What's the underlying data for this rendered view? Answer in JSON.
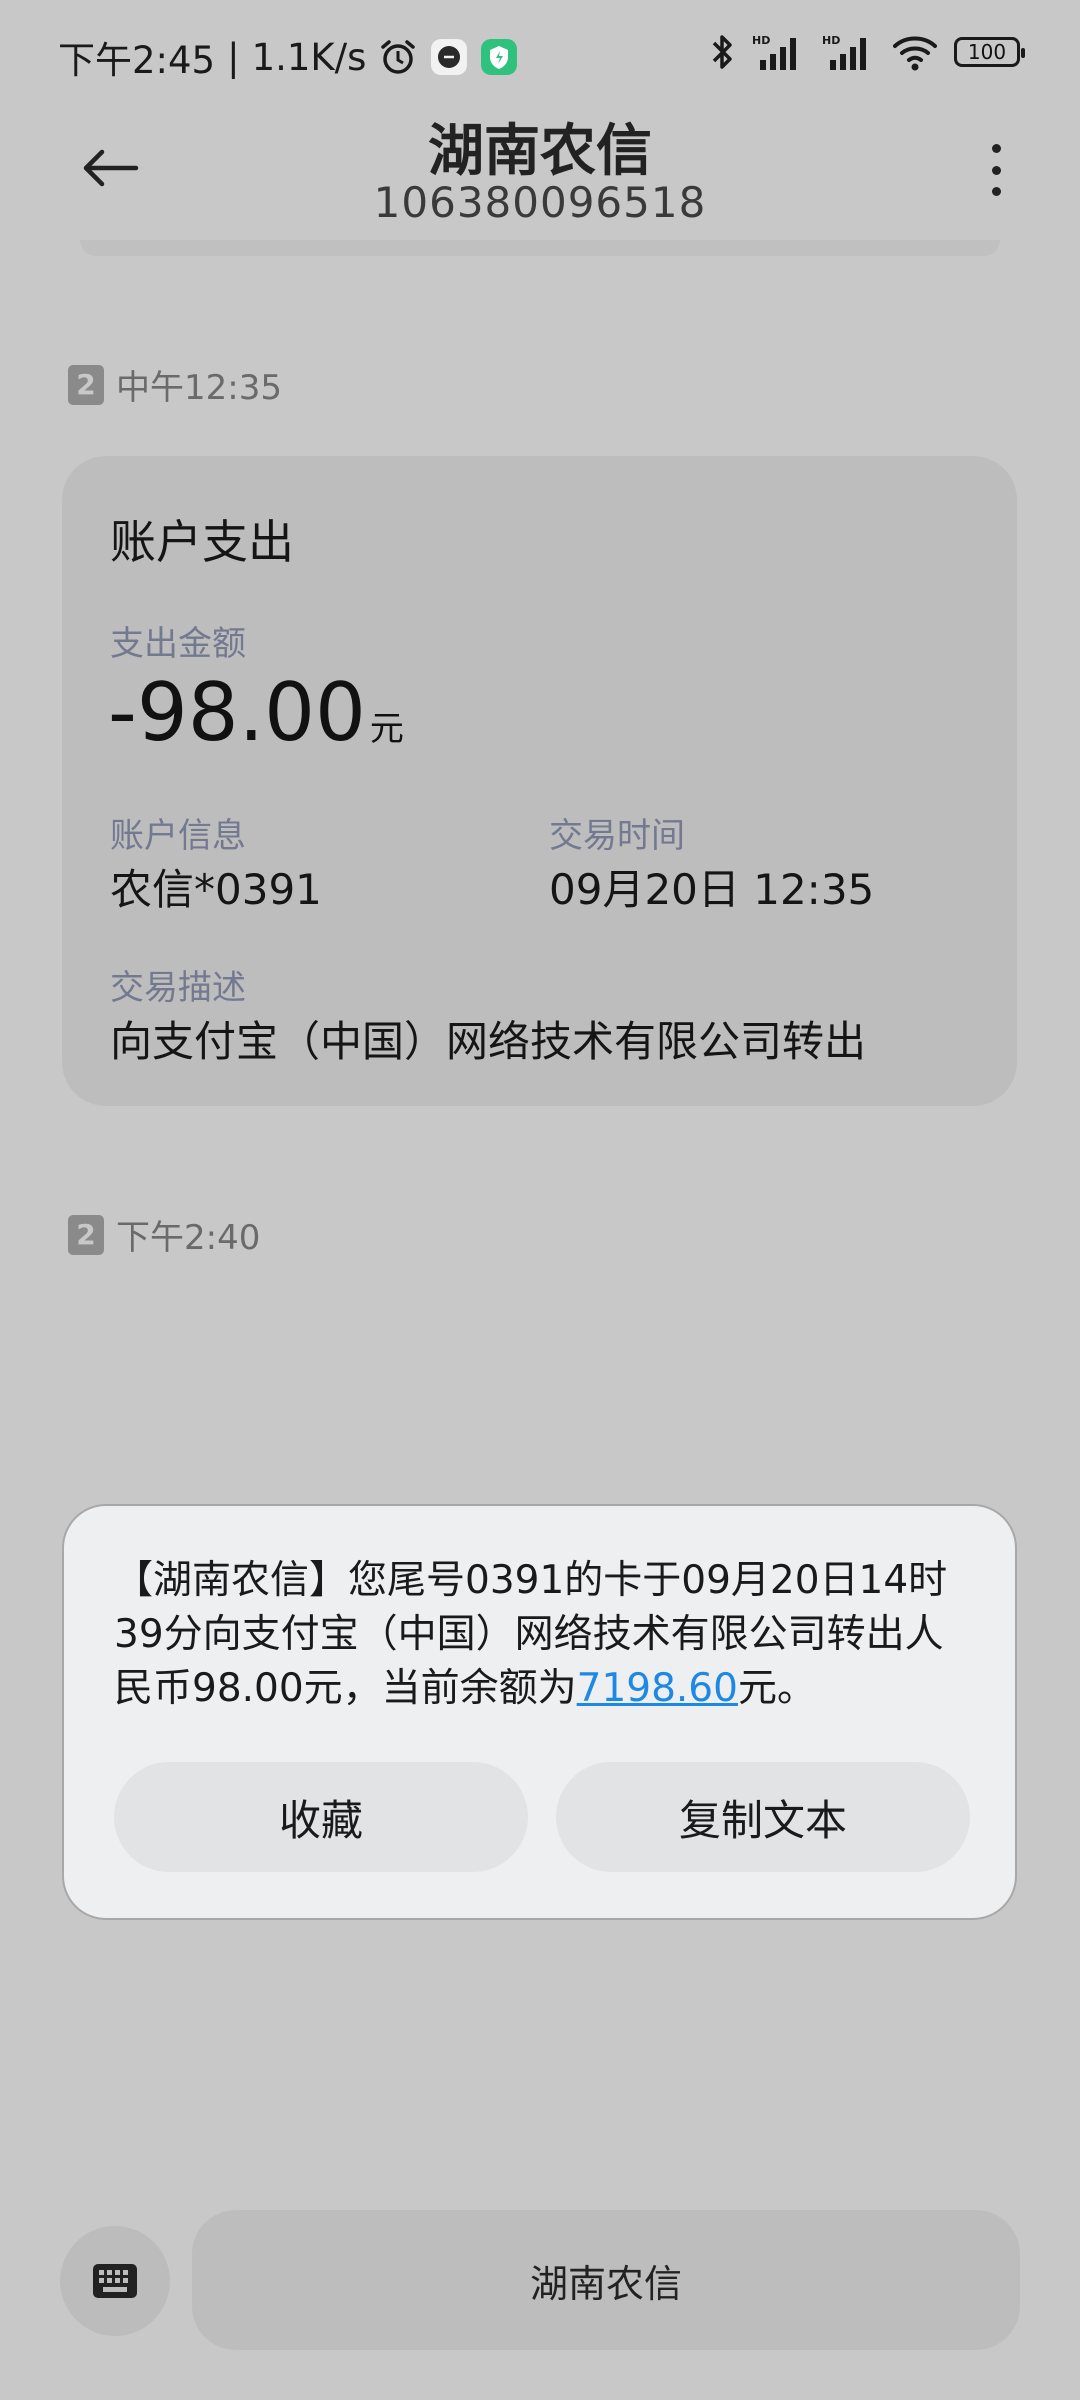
{
  "status_bar": {
    "time": "下午2:45",
    "net_speed": "1.1K/s",
    "battery": "100",
    "icons": [
      "alarm-icon",
      "app-icon",
      "shield-app-icon",
      "bluetooth-icon",
      "signal-hd-icon",
      "signal-hd-icon",
      "wifi-icon",
      "battery-icon"
    ]
  },
  "header": {
    "title": "湖南农信",
    "number": "106380096518",
    "back_icon": "arrow-left-icon",
    "more_icon": "more-vertical-icon"
  },
  "messages": [
    {
      "sim": "2",
      "time": "中午12:35"
    },
    {
      "sim": "2",
      "time": "下午2:40"
    }
  ],
  "card": {
    "title": "账户支出",
    "amount_label": "支出金额",
    "amount": "-98.00",
    "amount_unit": "元",
    "account_label": "账户信息",
    "account_value": "农信*0391",
    "time_label": "交易时间",
    "time_value": "09月20日 12:35",
    "desc_label": "交易描述",
    "desc_value": "向支付宝（中国）网络技术有限公司转出"
  },
  "dialog": {
    "text_before": "【湖南农信】您尾号0391的卡于09月20日14时39分向支付宝（中国）网络技术有限公司转出人民币98.00元，当前余额为",
    "balance_link": "7198.60",
    "text_after": "元。",
    "favorite_label": "收藏",
    "copy_label": "复制文本"
  },
  "bottom": {
    "keyboard_icon": "keyboard-icon",
    "input_label": "湖南农信"
  },
  "colors": {
    "background": "#c8c8c8",
    "card": "#bdbdbd",
    "dialog": "#eeeff1",
    "link": "#1e88e5",
    "label": "#737a90"
  }
}
